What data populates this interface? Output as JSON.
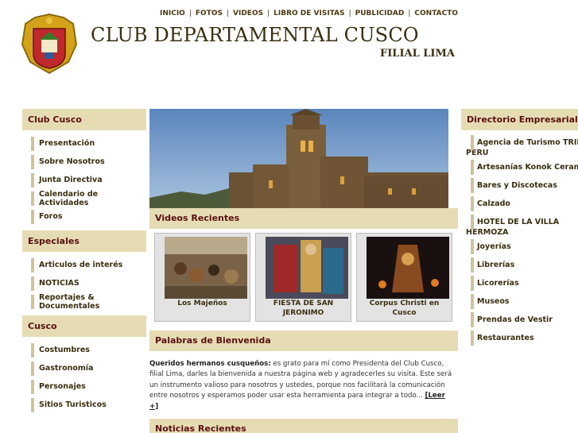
{
  "header": {
    "title": "CLUB DEPARTAMENTAL CUSCO",
    "subtitle": "FILIAL LIMA",
    "logo_icon": "coat-of-arms-icon"
  },
  "topnav": [
    "INICIO",
    "FOTOS",
    "VIDEOS",
    "LIBRO DE VISITAS",
    "PUBLICIDAD",
    "CONTACTO"
  ],
  "left_sidebar": {
    "club": {
      "title": "Club Cusco",
      "items": [
        "Presentación",
        "Sobre Nosotros",
        "Junta Directiva",
        "Calendario de Actividades",
        "Foros"
      ]
    },
    "especiales": {
      "title": "Especiales",
      "items": [
        "Articulos de interés",
        "NOTICIAS",
        "Reportajes & Documentales"
      ]
    },
    "cusco": {
      "title": "Cusco",
      "items": [
        "Costumbres",
        "Gastronomía",
        "Personajes",
        "Sitios Turisticos"
      ]
    }
  },
  "right_sidebar": {
    "title": "Directorio Empresarial",
    "items": [
      "Agencia de Turismo TRIPS PERU",
      "Artesanías Konok Ceramica",
      "Bares y Discotecas",
      "Calzado",
      "HOTEL DE LA VILLA HERMOZA",
      "Joyerías",
      "Librerías",
      "Licorerías",
      "Museos",
      "Prendas de Vestir",
      "Restaurantes"
    ]
  },
  "main": {
    "videos_title": "Videos Recientes",
    "videos": [
      {
        "caption": "Los Majeños"
      },
      {
        "caption": "FIESTA DE SAN JERONIMO"
      },
      {
        "caption": "Corpus Christi en Cusco"
      }
    ],
    "welcome_title": "Palabras de Bienvenida",
    "welcome_lead": "Queridos hermanos cusqueños:",
    "welcome_text": " es grato para mí como Presidenta del Club Cusco, filial Lima, darles la bienvenida a nuestra página web y agradecerles su visita. Este será un instrumento valioso para nosotros y ustedes, porque nos facilitará la comunicación entre nosotros y esperamos poder usar esta herramienta para integrar a todo... ",
    "read_more": "[Leer +]",
    "news_title": "Noticias Recientes"
  },
  "colors": {
    "section_bg": "#e6dcb4",
    "section_text": "#5a1010",
    "bar": "#cfc39a"
  }
}
